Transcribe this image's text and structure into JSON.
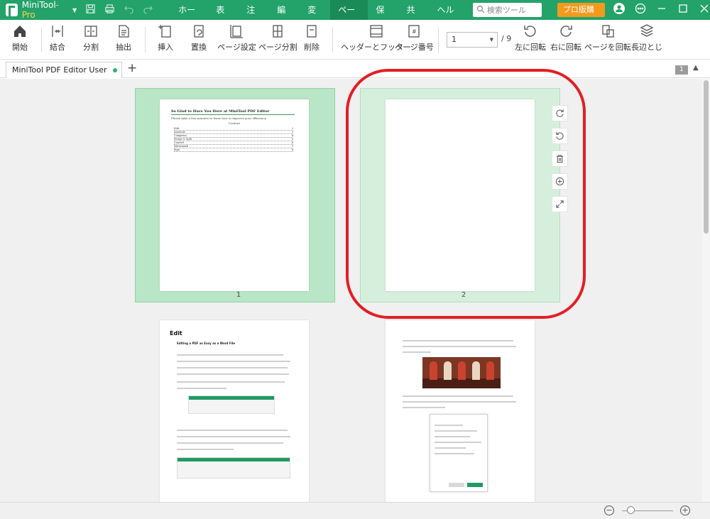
{
  "app": {
    "name": "MiniTool",
    "edition": "-Pro"
  },
  "menu": {
    "items": [
      "ホーム",
      "表示",
      "注釈",
      "編集",
      "変換",
      "ページ",
      "保護",
      "共有",
      "ヘルプ"
    ],
    "active_index": 5,
    "search_placeholder": "検索ツール",
    "buy_label": "プロ版購入"
  },
  "ribbon": {
    "home": "開始",
    "merge": "結合",
    "split": "分割",
    "extract": "抽出",
    "insert": "挿入",
    "replace": "置換",
    "page_setup": "ページ設定",
    "page_split": "ページ分割",
    "delete": "削除",
    "header_footer": "ヘッダーとフッター",
    "page_number": "ページ番号",
    "current_page": "1",
    "total_pages": "/ 9",
    "rotate_left": "左に回転",
    "rotate_right": "右に回転",
    "rotate_page": "ページを回転",
    "long_edge": "長辺とじ"
  },
  "tabs": {
    "doc_title": "MiniTool PDF Editor User ...pdf",
    "add": "+",
    "page_badge": "1"
  },
  "pages": {
    "p1": {
      "number": "1",
      "title": "So Glad to Have You Here at MiniTool PDF Editor",
      "subtitle": "Please take a few minutes to learn how to improve your efficiency",
      "contents_title": "Content",
      "toc": [
        {
          "label": "Edit",
          "page": "2"
        },
        {
          "label": "Annotate",
          "page": "3"
        },
        {
          "label": "Compress",
          "page": "4"
        },
        {
          "label": "Merge & Split",
          "page": "5"
        },
        {
          "label": "Convert",
          "page": "6"
        },
        {
          "label": "Watermark",
          "page": "7"
        },
        {
          "label": "Sign",
          "page": "8"
        }
      ]
    },
    "p2": {
      "number": "2"
    },
    "p3": {
      "title": "Edit",
      "subtitle": "Editing a PDF as Easy as a Word File"
    }
  },
  "colors": {
    "brand_green": "#23a26a",
    "selected_page_bg": "#b9e6c6",
    "highlight_red": "#e31e24",
    "buy_orange": "#f39a1d"
  }
}
